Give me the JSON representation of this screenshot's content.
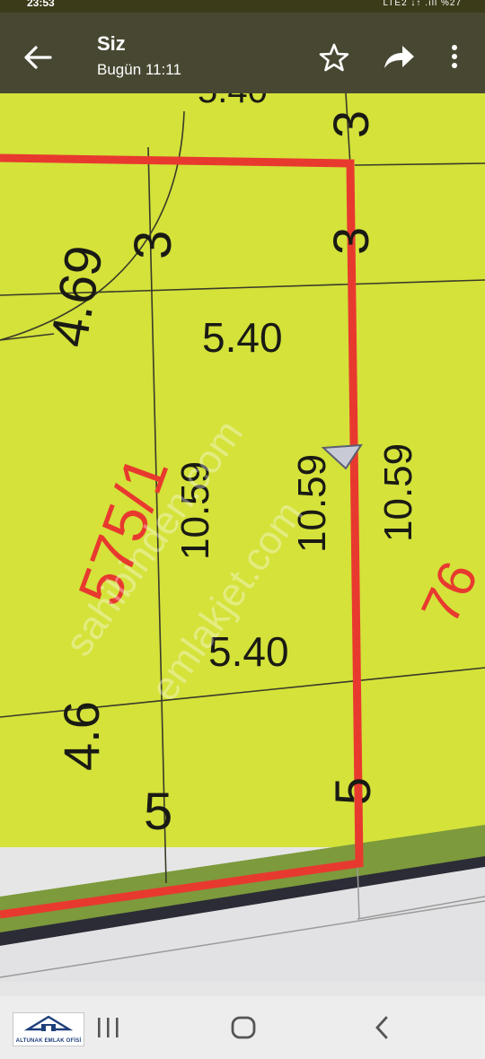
{
  "status_bar": {
    "time": "23:53",
    "network": "LTE2",
    "battery": "%27"
  },
  "header": {
    "sender": "Siz",
    "timestamp": "Bugün 11:11",
    "icons": [
      "back-arrow-icon",
      "star-icon",
      "share-icon",
      "more-vertical-icon"
    ]
  },
  "map": {
    "parcel_number": "575/1",
    "neighbor_parcel_fragment": "76",
    "top_partial": "5.40",
    "curve_dimension": "4.69",
    "upper_width": "5.40",
    "lower_width": "5.40",
    "side_lengths": [
      "10.59",
      "10.59",
      "10.59"
    ],
    "left_dimension": "4.6",
    "setback_top_left": "3",
    "setback_top_right_a": "3",
    "setback_top_right_b": "3",
    "setback_bottom_left": "5",
    "setback_bottom_right": "5",
    "watermarks": [
      "sahibinden.com",
      "emlakjet.com"
    ],
    "colors": {
      "parcel_fill": "#d4e23a",
      "boundary_red": "#e8392f",
      "road_band": "#7d9a3c"
    }
  },
  "nav_bar": {
    "logo_text": "ALTUNAK EMLAK OFİSİ",
    "icons": [
      "recent-apps-icon",
      "home-icon",
      "back-icon"
    ]
  }
}
